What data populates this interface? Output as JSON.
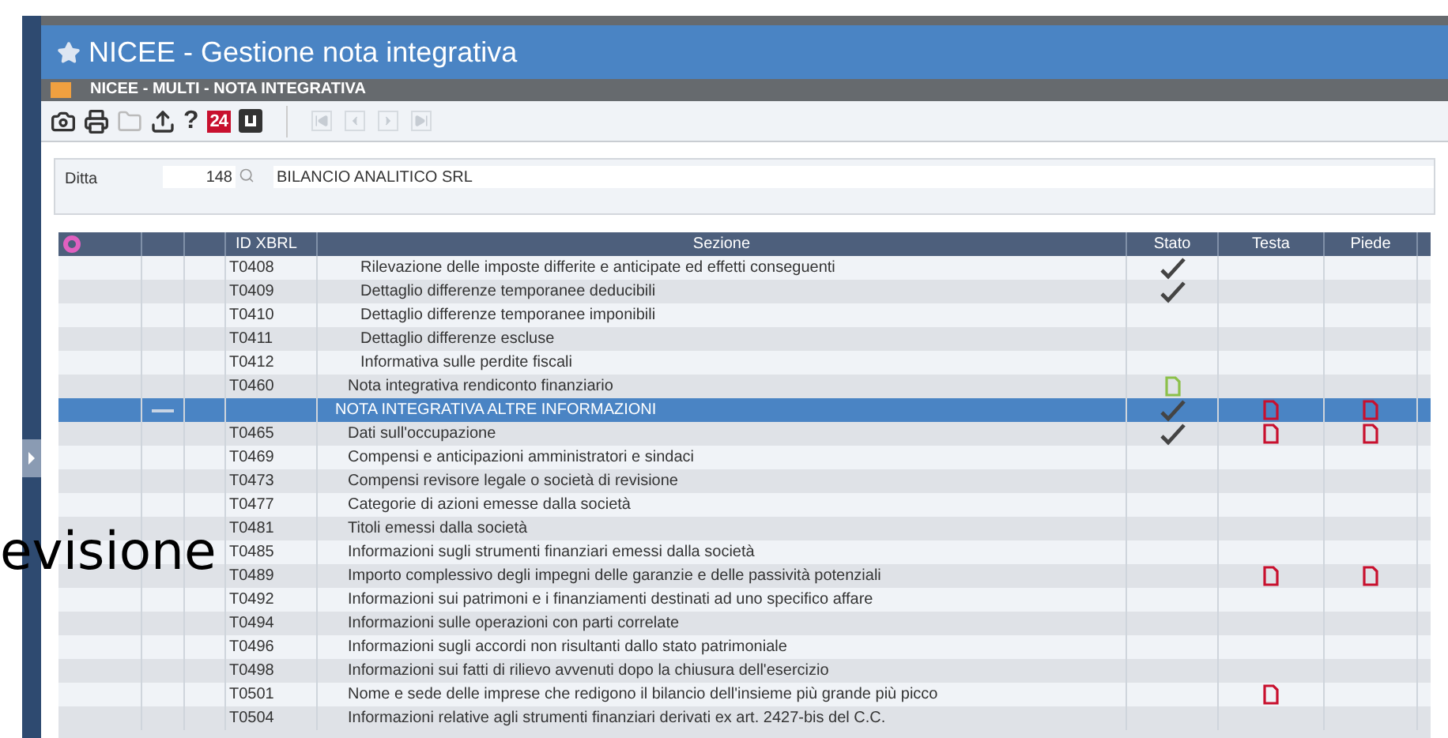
{
  "window": {
    "title": "NICEE - Gestione nota integrativa"
  },
  "subwindow": {
    "title": "NICEE - MULTI - NOTA INTEGRATIVA"
  },
  "toolbar": {
    "help": "?",
    "calendar": "24",
    "nav_disabled": true
  },
  "form": {
    "label": "Ditta",
    "code": "148",
    "name": "BILANCIO ANALITICO SRL"
  },
  "table": {
    "columns": [
      "ID XBRL",
      "Sezione",
      "Stato",
      "Testa",
      "Piede"
    ],
    "rows": [
      {
        "kind": "sub",
        "id": "T0408",
        "section": "Rilevazione delle imposte differite e anticipate ed effetti conseguenti",
        "done": true,
        "draft": false,
        "testa": false,
        "piede": false,
        "selected": false
      },
      {
        "kind": "sub",
        "id": "T0409",
        "section": "Dettaglio differenze temporanee deducibili",
        "done": true,
        "draft": false,
        "testa": false,
        "piede": false,
        "selected": false
      },
      {
        "kind": "sub",
        "id": "T0410",
        "section": "Dettaglio differenze temporanee imponibili",
        "done": false,
        "draft": false,
        "testa": false,
        "piede": false,
        "selected": false
      },
      {
        "kind": "sub",
        "id": "T0411",
        "section": "Dettaglio differenze escluse",
        "done": false,
        "draft": false,
        "testa": false,
        "piede": false,
        "selected": false
      },
      {
        "kind": "sub",
        "id": "T0412",
        "section": "Informativa sulle perdite fiscali",
        "done": false,
        "draft": false,
        "testa": false,
        "piede": false,
        "selected": false
      },
      {
        "kind": "item",
        "id": "T0460",
        "section": "Nota integrativa rendiconto finanziario",
        "done": false,
        "draft": true,
        "testa": false,
        "piede": false,
        "selected": false
      },
      {
        "kind": "group",
        "expanded": true,
        "section": "NOTA INTEGRATIVA ALTRE INFORMAZIONI",
        "done": true,
        "draft": false,
        "testa": true,
        "piede": true,
        "selected": true
      },
      {
        "kind": "item",
        "id": "T0465",
        "section": "Dati sull'occupazione",
        "done": true,
        "draft": false,
        "testa": true,
        "piede": true,
        "selected": false
      },
      {
        "kind": "item",
        "id": "T0469",
        "section": "Compensi e anticipazioni amministratori e sindaci",
        "done": false,
        "draft": false,
        "testa": false,
        "piede": false,
        "selected": false
      },
      {
        "kind": "item",
        "id": "T0473",
        "section": "Compensi revisore legale o società di revisione",
        "done": false,
        "draft": false,
        "testa": false,
        "piede": false,
        "selected": false
      },
      {
        "kind": "item",
        "id": "T0477",
        "section": "Categorie di azioni emesse dalla società",
        "done": false,
        "draft": false,
        "testa": false,
        "piede": false,
        "selected": false
      },
      {
        "kind": "item",
        "id": "T0481",
        "section": "Titoli emessi dalla società",
        "done": false,
        "draft": false,
        "testa": false,
        "piede": false,
        "selected": false
      },
      {
        "kind": "item",
        "id": "T0485",
        "section": "Informazioni sugli strumenti finanziari emessi dalla società",
        "done": false,
        "draft": false,
        "testa": false,
        "piede": false,
        "selected": false
      },
      {
        "kind": "item",
        "id": "T0489",
        "section": "Importo complessivo degli impegni delle garanzie e delle passività potenziali",
        "done": false,
        "draft": false,
        "testa": true,
        "piede": true,
        "selected": false
      },
      {
        "kind": "item",
        "id": "T0492",
        "section": "Informazioni sui patrimoni e i finanziamenti destinati ad uno specifico affare",
        "done": false,
        "draft": false,
        "testa": false,
        "piede": false,
        "selected": false
      },
      {
        "kind": "item",
        "id": "T0494",
        "section": "Informazioni sulle operazioni con parti correlate",
        "done": false,
        "draft": false,
        "testa": false,
        "piede": false,
        "selected": false
      },
      {
        "kind": "item",
        "id": "T0496",
        "section": "Informazioni sugli accordi non risultanti dallo stato patrimoniale",
        "done": false,
        "draft": false,
        "testa": false,
        "piede": false,
        "selected": false
      },
      {
        "kind": "item",
        "id": "T0498",
        "section": "Informazioni sui fatti di rilievo avvenuti dopo la chiusura dell'esercizio",
        "done": false,
        "draft": false,
        "testa": false,
        "piede": false,
        "selected": false
      },
      {
        "kind": "item",
        "id": "T0501",
        "section": "Nome e sede delle imprese che redigono il bilancio dell'insieme più grande più picco",
        "done": false,
        "draft": false,
        "testa": true,
        "piede": false,
        "selected": false
      },
      {
        "kind": "item",
        "id": "T0504",
        "section": "Informazioni relative agli strumenti finanziari derivati ex art. 2427-bis del C.C.",
        "done": false,
        "draft": false,
        "testa": false,
        "piede": false,
        "selected": false
      }
    ]
  },
  "overlay_text": "evisione"
}
